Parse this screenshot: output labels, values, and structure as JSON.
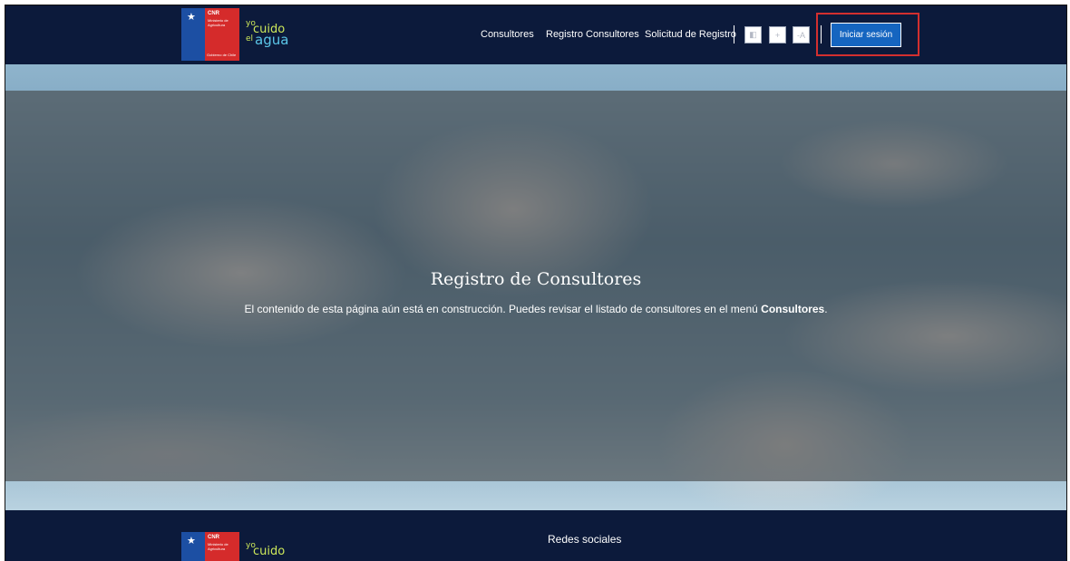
{
  "header": {
    "gov_logo": {
      "title": "CNR",
      "subtitle": "Ministerio de Agricultura",
      "caption": "Gobierno de Chile"
    },
    "brand": {
      "yo": "yo",
      "cuido": "cuido",
      "el": "el",
      "agua": "agua"
    },
    "nav": {
      "consultores": "Consultores",
      "registro": "Registro Consultores",
      "solicitud": "Solicitud de Registro"
    },
    "a11y": {
      "contrast": "◧",
      "decrease": "+",
      "increase": "-A"
    },
    "login": "Iniciar sesión"
  },
  "hero": {
    "title": "Registro de Consultores",
    "text_prefix": "El contenido de esta página aún está en construcción. Puedes revisar el listado de consultores en el menú ",
    "text_bold": "Consultores",
    "text_suffix": "."
  },
  "footer": {
    "title": "Redes sociales",
    "brand": {
      "yo": "yo",
      "cuido": "cuido"
    }
  },
  "colors": {
    "header_bg": "#0c1a3b",
    "login_bg": "#1565c0",
    "highlight": "#d32f2f"
  }
}
